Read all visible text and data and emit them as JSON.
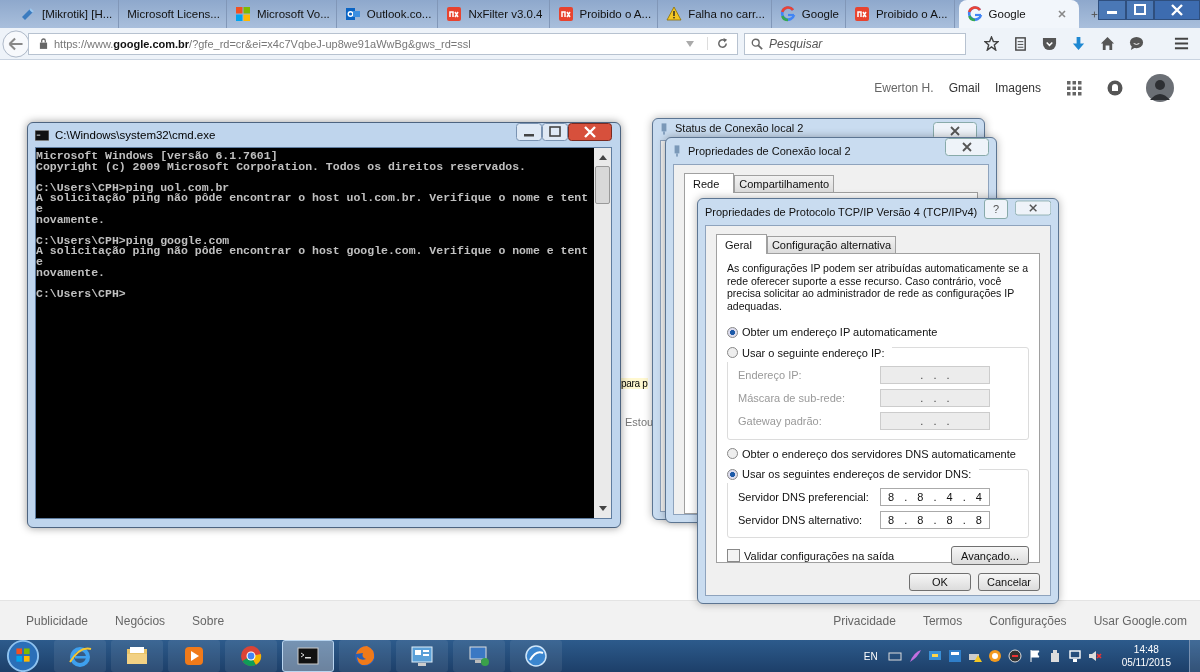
{
  "browser": {
    "tabs": [
      {
        "title": "[Mikrotik] [H...",
        "kind": "network",
        "selected": false
      },
      {
        "title": "Microsoft Licens...",
        "kind": "plain",
        "selected": false
      },
      {
        "title": "Microsoft Vo...",
        "kind": "windows",
        "selected": false
      },
      {
        "title": "Outlook.co...",
        "kind": "mail",
        "selected": false
      },
      {
        "title": "NxFilter v3.0.4",
        "kind": "filter",
        "selected": false
      },
      {
        "title": "Proibido o A...",
        "kind": "filter",
        "selected": false
      },
      {
        "title": "Falha no carr...",
        "kind": "warning",
        "selected": false
      },
      {
        "title": "Google",
        "kind": "search",
        "selected": false
      },
      {
        "title": "Proibido o A...",
        "kind": "filter",
        "selected": false
      },
      {
        "title": "Google",
        "kind": "search",
        "selected": true
      }
    ],
    "url": "https://www.**google.com.br**/?gfe_rd=cr&ei=x4c7VqbeJ-up8we91aWwBg&gws_rd=ssl",
    "search_placeholder": "Pesquisar"
  },
  "google_header": {
    "user": "Ewerton H.",
    "links": [
      "Gmail",
      "Imagens"
    ]
  },
  "page_fragments": {
    "hint": "para p",
    "button": "Estou"
  },
  "footer": {
    "left": [
      "Publicidade",
      "Negócios",
      "Sobre"
    ],
    "right": [
      "Privacidade",
      "Termos",
      "Configurações",
      "Usar Google.com"
    ]
  },
  "cmd_window": {
    "title": "C:\\Windows\\system32\\cmd.exe",
    "blocks": [
      [
        "Microsoft Windows [versão 6.1.7601]",
        "Copyright (c) 2009 Microsoft Corporation. Todos os direitos reservados."
      ],
      [
        "C:\\Users\\CPH>ping uol.com.br",
        "A solicitação ping não pôde encontrar o host uol.com.br. Verifique o nome e tent",
        "e",
        "novamente."
      ],
      [
        "C:\\Users\\CPH>ping google.com",
        "A solicitação ping não pôde encontrar o host google.com. Verifique o nome e tent",
        "e",
        "novamente."
      ],
      [
        "C:\\Users\\CPH>"
      ]
    ]
  },
  "status_window": {
    "title": "Status de Conexão local 2"
  },
  "connection_window": {
    "title": "Propriedades de Conexão local 2",
    "tabs": [
      {
        "label": "Rede",
        "selected": true
      },
      {
        "label": "Compartilhamento",
        "selected": false
      }
    ]
  },
  "tcp_window": {
    "title": "Propriedades de Protocolo TCP/IP Versão 4 (TCP/IPv4)",
    "help": "?",
    "tabs": [
      {
        "label": "Geral",
        "selected": true
      },
      {
        "label": "Configuração alternativa",
        "selected": false
      }
    ],
    "intro": "As configurações IP podem ser atribuídas automaticamente se a rede oferecer suporte a esse recurso. Caso contrário, você precisa solicitar ao administrador de rede as configurações IP adequadas.",
    "ip_options": [
      {
        "label": "Obter um endereço IP automaticamente",
        "selected": true
      },
      {
        "label": "Usar o seguinte endereço IP:",
        "selected": false
      }
    ],
    "ip_fields": [
      {
        "label": "Endereço IP:",
        "value": ". . .",
        "disabled": true
      },
      {
        "label": "Máscara de sub-rede:",
        "value": ". . .",
        "disabled": true
      },
      {
        "label": "Gateway padrão:",
        "value": ". . .",
        "disabled": true
      }
    ],
    "dns_options": [
      {
        "label": "Obter o endereço dos servidores DNS automaticamente",
        "selected": false
      },
      {
        "label": "Usar os seguintes endereços de servidor DNS:",
        "selected": true
      }
    ],
    "dns_fields": [
      {
        "label": "Servidor DNS preferencial:",
        "value": "8 . 8 . 4 . 4",
        "disabled": false
      },
      {
        "label": "Servidor DNS alternativo:",
        "value": "8 . 8 . 8 . 8",
        "disabled": false
      }
    ],
    "validate": {
      "label": "Validar configurações na saída",
      "checked": false
    },
    "advanced_button": "Avançado...",
    "ok_button": "OK",
    "cancel_button": "Cancelar"
  },
  "taskbar": {
    "items": [
      {
        "kind": "ie",
        "selected": false
      },
      {
        "kind": "folder",
        "selected": false
      },
      {
        "kind": "media",
        "selected": false
      },
      {
        "kind": "chrome",
        "selected": false
      },
      {
        "kind": "cmd",
        "selected": true
      },
      {
        "kind": "firefox",
        "selected": false
      },
      {
        "kind": "panel",
        "selected": false
      },
      {
        "kind": "network",
        "selected": false
      },
      {
        "kind": "globe",
        "selected": false
      }
    ],
    "language": "EN",
    "time": "14:48",
    "date": "05/11/2015"
  }
}
